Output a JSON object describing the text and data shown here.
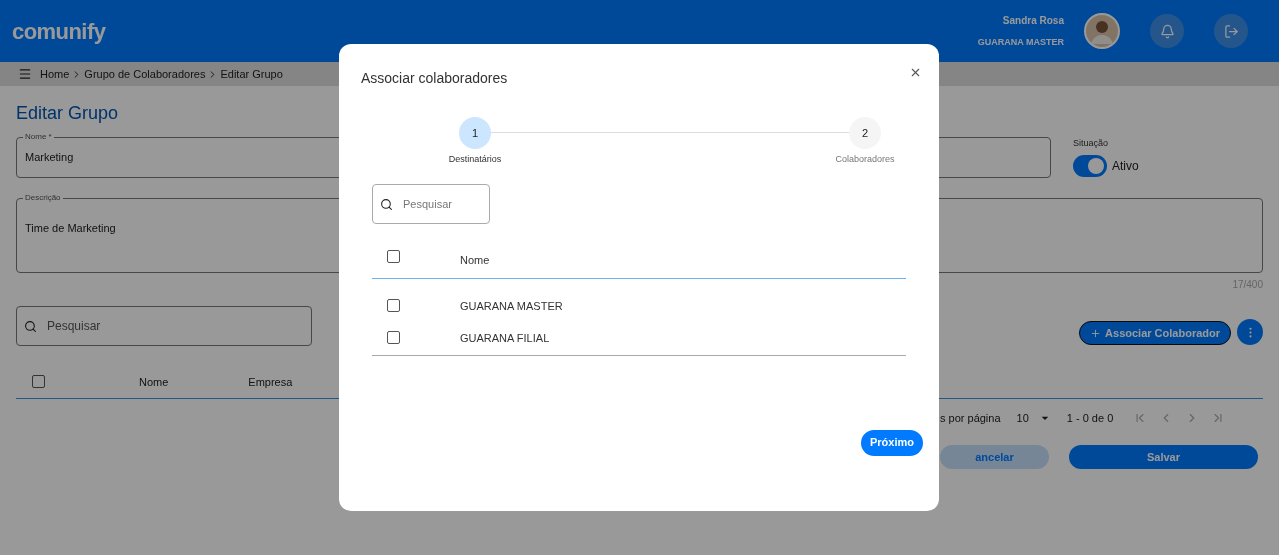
{
  "header": {
    "logo": "comunify",
    "user_name": "Sandra Rosa",
    "company": "GUARANA MASTER"
  },
  "breadcrumb": [
    "Home",
    "Grupo de Colaboradores",
    "Editar Grupo"
  ],
  "page_title": "Editar Grupo",
  "name_field": {
    "label": "Nome *",
    "value": "Marketing"
  },
  "status": {
    "label": "Situação",
    "on": true,
    "text": "Ativo"
  },
  "description_field": {
    "label": "Descrição",
    "value": "Time de Marketing",
    "counter": "17/400"
  },
  "search": {
    "placeholder": "Pesquisar"
  },
  "associate_button": "Associar Colaborador",
  "table": {
    "select_all": {
      "checked": false
    },
    "columns": [
      "Nome",
      "Empresa"
    ]
  },
  "pagination": {
    "rows_label": "s por página",
    "rows_value": "10",
    "range": "1 - 0 de 0"
  },
  "buttons": {
    "cancel": "ancelar",
    "save": "Salvar"
  },
  "modal": {
    "title": "Associar colaboradores",
    "steps": [
      {
        "number": "1",
        "label": "Destinatários",
        "selected": true
      },
      {
        "number": "2",
        "label": "Colaboradores",
        "selected": false
      }
    ],
    "search": {
      "placeholder": "Pesquisar"
    },
    "select_all": {
      "checked": false
    },
    "column": "Nome",
    "rows": [
      {
        "name": "GUARANA MASTER",
        "checked": false
      },
      {
        "name": "GUARANA FILIAL",
        "checked": false
      }
    ],
    "next_button": "Próximo"
  }
}
